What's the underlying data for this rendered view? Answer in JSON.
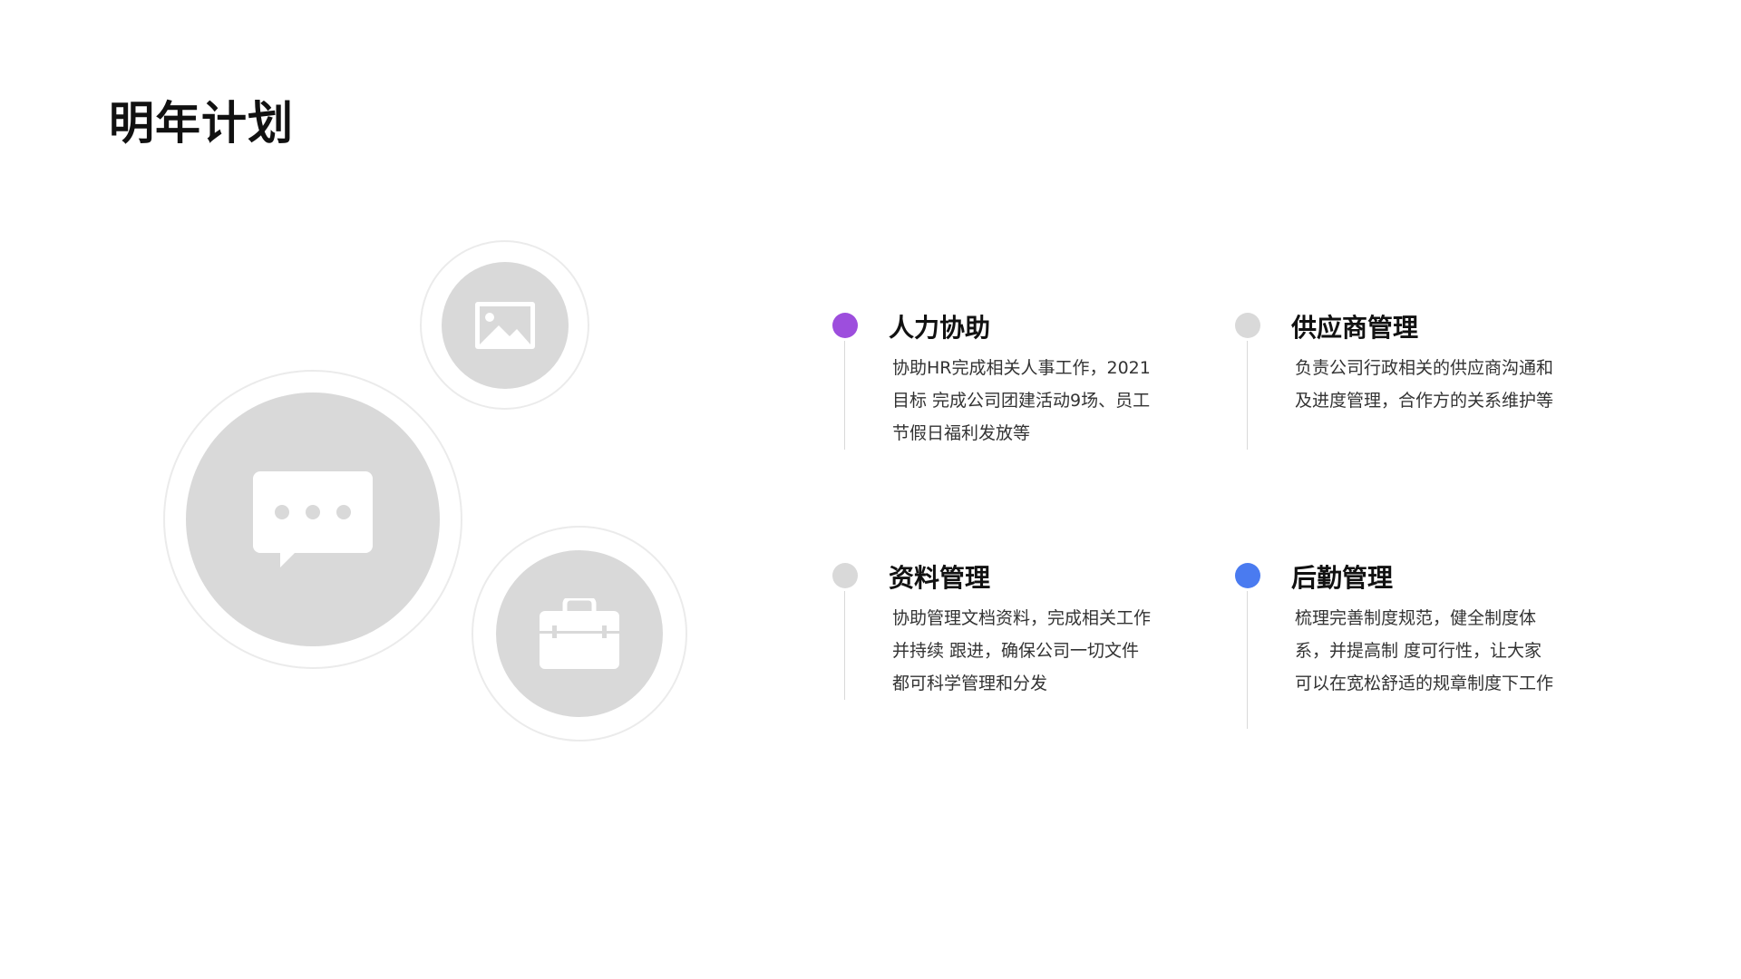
{
  "page": {
    "title": "明年计划"
  },
  "decor": {
    "large_icon": "chat-bubble-icon",
    "small_icon": "image-icon",
    "mid_icon": "briefcase-icon",
    "circle_fill": "#d9d9d9",
    "ring_stroke": "#ebebeb"
  },
  "plans": [
    {
      "title": "人力协助",
      "description": "协助HR完成相关人事工作，2021目标 完成公司团建活动9场、员工节假日福利发放等",
      "dot_color": "#9d4edd"
    },
    {
      "title": "供应商管理",
      "description": "负责公司行政相关的供应商沟通和及进度管理，合作方的关系维护等",
      "dot_color": "#d9d9d9"
    },
    {
      "title": "资料管理",
      "description": "协助管理文档资料，完成相关工作并持续 跟进，确保公司一切文件都可科学管理和分发",
      "dot_color": "#d9d9d9"
    },
    {
      "title": "后勤管理",
      "description": "梳理完善制度规范，健全制度体系，并提高制 度可行性，让大家可以在宽松舒适的规章制度下工作",
      "dot_color": "#4a7bf0"
    }
  ]
}
